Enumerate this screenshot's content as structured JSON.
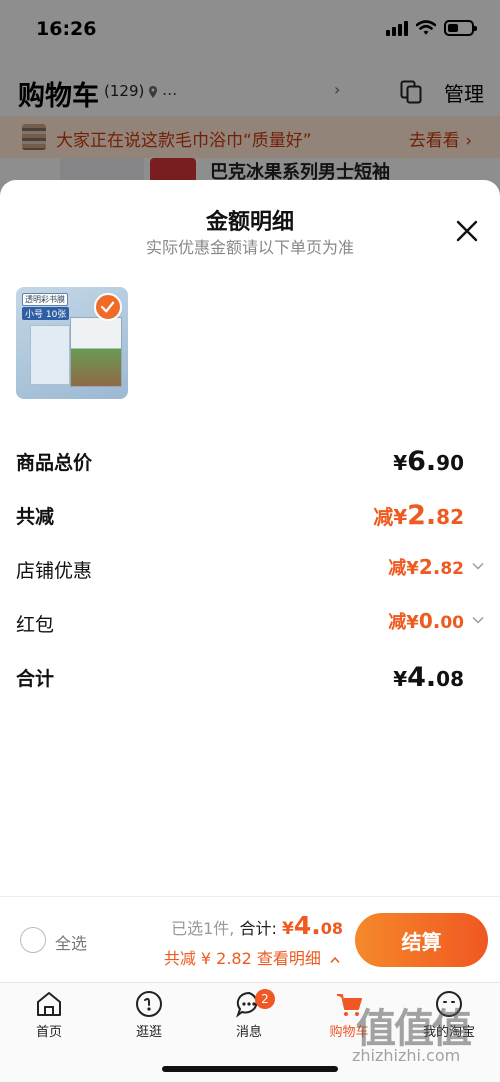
{
  "status_bar": {
    "time": "16:26"
  },
  "background_page": {
    "title": "购物车",
    "count": "(129)",
    "location": "...",
    "location_arrow": "›",
    "manage_label": "管理",
    "promo_text": "大家正在说这款毛巾浴巾“质量好”",
    "promo_link": "去看看 ›",
    "peek_item_text": "巴克冰果系列男士短袖"
  },
  "sheet": {
    "title": "金额明细",
    "subtitle": "实际优惠金额请以下单页为准",
    "product_card": {
      "label1": "透明彩书膜",
      "label2": "小号 10张"
    },
    "rows": [
      {
        "label": "商品总价",
        "prefix": "",
        "currency": "¥",
        "int": "6.",
        "dec": "90",
        "style": "total"
      },
      {
        "label": "共减",
        "prefix": "减",
        "currency": "¥",
        "int": "2.",
        "dec": "82",
        "style": "discount"
      },
      {
        "label": "店铺优惠",
        "prefix": "减",
        "currency": "¥",
        "int": "2.",
        "dec": "82",
        "style": "detail"
      },
      {
        "label": "红包",
        "prefix": "减",
        "currency": "¥",
        "int": "0.",
        "dec": "00",
        "style": "detail"
      },
      {
        "label": "合计",
        "prefix": "",
        "currency": "¥",
        "int": "4.",
        "dec": "08",
        "style": "total"
      }
    ]
  },
  "checkout": {
    "select_all": "全选",
    "selected_text": "已选1件,",
    "total_label": "合计:",
    "total_currency": "¥",
    "total_int": "4.",
    "total_dec": "08",
    "discount_text": "共减 ¥ 2.82",
    "detail_link": "查看明细",
    "checkout_label": "结算"
  },
  "tab_bar": {
    "tabs": [
      {
        "label": "首页",
        "icon": "home-icon"
      },
      {
        "label": "逛逛",
        "icon": "explore-icon"
      },
      {
        "label": "消息",
        "icon": "message-icon",
        "badge": "2"
      },
      {
        "label": "购物车",
        "icon": "cart-icon",
        "active": true
      },
      {
        "label": "我的淘宝",
        "icon": "profile-icon"
      }
    ]
  },
  "watermark": {
    "logo": "值",
    "text": "zhizhizhi.com"
  },
  "colors": {
    "accent": "#f05722",
    "discount_red": "#ee5a1f",
    "promo_bg": "#fbe3d1"
  }
}
